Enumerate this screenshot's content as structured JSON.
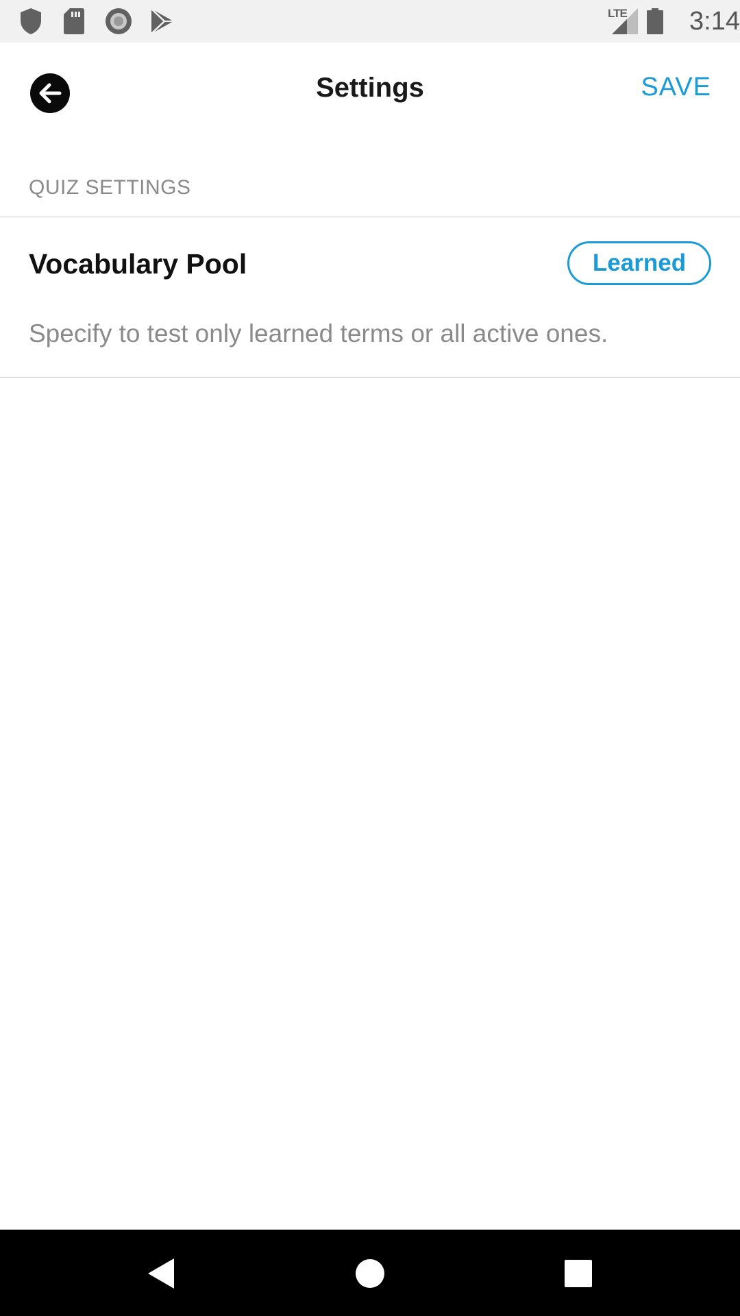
{
  "status_bar": {
    "time": "3:14",
    "network": "LTE",
    "left_icons": [
      "shield-icon",
      "sd-card-icon",
      "record-icon",
      "play-store-icon"
    ],
    "right_icons": [
      "lte-signal-icon",
      "battery-icon"
    ]
  },
  "app_bar": {
    "title": "Settings",
    "save_label": "SAVE",
    "back_icon": "back-arrow-icon"
  },
  "section": {
    "header": "QUIZ SETTINGS"
  },
  "setting": {
    "title": "Vocabulary Pool",
    "value": "Learned",
    "description": "Specify to test only learned terms or all active ones."
  },
  "nav_bar": {
    "icons": [
      "nav-back-icon",
      "nav-home-icon",
      "nav-recents-icon"
    ]
  },
  "colors": {
    "accent": "#1a9ad6",
    "status_bar_bg": "#f1f1f1",
    "secondary_text": "#8a8a8a"
  }
}
